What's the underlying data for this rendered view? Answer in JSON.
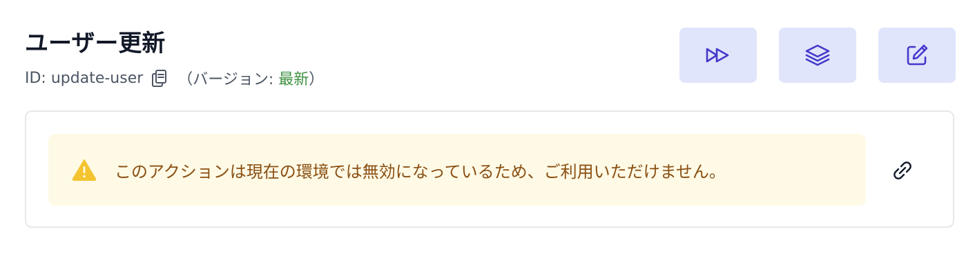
{
  "header": {
    "title": "ユーザー更新",
    "id_label": "ID: update-user",
    "version_prefix": "（バージョン: ",
    "version_value": "最新",
    "version_suffix": "）"
  },
  "icons": {
    "copy": "clipboard-copy-icon",
    "run": "fast-forward-icon",
    "versions": "layers-stack-icon",
    "edit": "pencil-square-icon",
    "warning": "warning-triangle-icon",
    "link": "chain-link-icon"
  },
  "alert": {
    "message": "このアクションは現在の環境では無効になっているため、ご利用いただけません。"
  },
  "colors": {
    "accent": "#4338ca",
    "button_bg": "#e0e5fb",
    "version_latest": "#3f9142",
    "alert_bg": "#fefae6",
    "alert_text": "#8a4f12",
    "warning_icon": "#f4c430"
  }
}
